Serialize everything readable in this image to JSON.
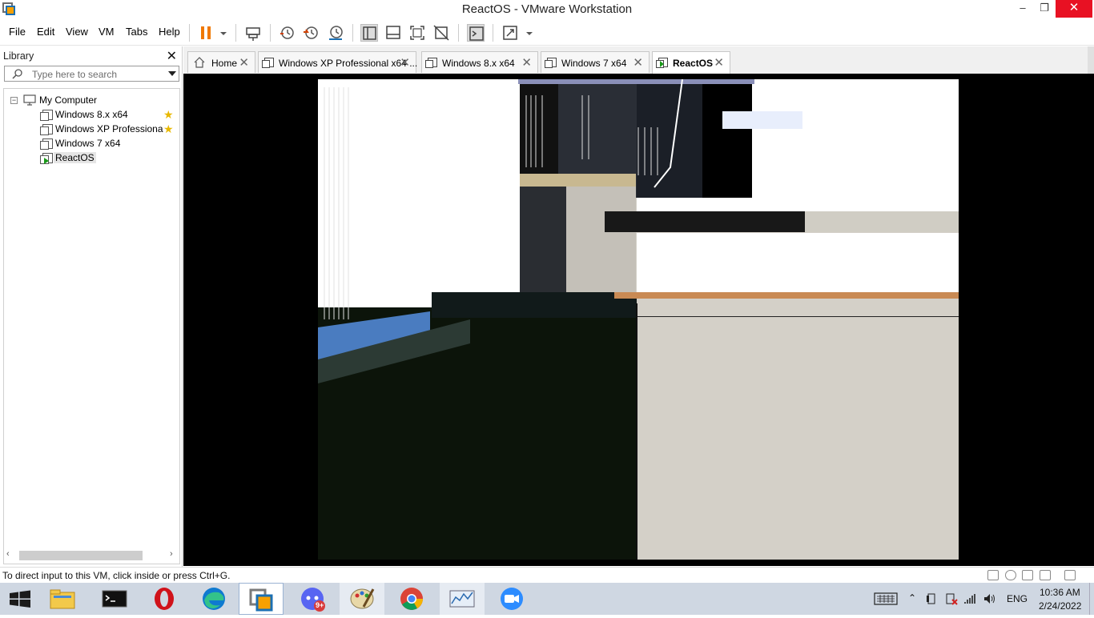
{
  "window": {
    "title": "ReactOS - VMware Workstation",
    "minimize": "–",
    "maximize": "❐",
    "close": "✕"
  },
  "menu": {
    "items": [
      "File",
      "Edit",
      "View",
      "VM",
      "Tabs",
      "Help"
    ]
  },
  "toolbar": {
    "accent": "#f07800",
    "icons": [
      "pause-icon",
      "dropdown-icon",
      "send-keys-icon",
      "snapshot-icon",
      "revert-snapshot-icon",
      "snapshot-manager-icon",
      "library-view-icon",
      "thumbnail-view-icon",
      "full-screen-icon",
      "unity-icon",
      "console-icon",
      "stretch-icon",
      "stretch-dropdown-icon"
    ]
  },
  "library": {
    "header": "Library",
    "close": "✕",
    "search_placeholder": "Type here to search",
    "root": {
      "label": "My Computer",
      "expander": "−"
    },
    "vms": [
      {
        "label": "Windows 8.x x64",
        "favorite": true,
        "running": false,
        "selected": false
      },
      {
        "label": "Windows XP Professiona",
        "favorite": true,
        "running": false,
        "selected": false
      },
      {
        "label": "Windows 7 x64",
        "favorite": false,
        "running": false,
        "selected": false
      },
      {
        "label": "ReactOS",
        "favorite": false,
        "running": true,
        "selected": true
      }
    ],
    "star": "★",
    "scroll_left": "‹",
    "scroll_right": "›"
  },
  "tabs": [
    {
      "label": "Home",
      "active": false,
      "icon": "home-icon"
    },
    {
      "label": "Windows XP Professional x64 ...",
      "active": false,
      "icon": "vm-icon"
    },
    {
      "label": "Windows 8.x x64",
      "active": false,
      "icon": "vm-icon"
    },
    {
      "label": "Windows 7 x64",
      "active": false,
      "icon": "vm-icon"
    },
    {
      "label": "ReactOS",
      "active": true,
      "icon": "vm-running-icon"
    }
  ],
  "tab_close": "✕",
  "status": {
    "message": "To direct input to this VM, click inside or press Ctrl+G."
  },
  "taskbar": {
    "apps": [
      "start-icon",
      "file-explorer-icon",
      "terminal-icon",
      "opera-icon",
      "edge-icon",
      "vmware-icon",
      "discord-icon",
      "paint-icon",
      "chrome-icon",
      "performance-monitor-icon",
      "zoom-icon"
    ],
    "discord_badge": "9+",
    "tray": {
      "language": "ENG",
      "time": "10:36 AM",
      "date": "2/24/2022",
      "overflow": "⌃"
    }
  }
}
